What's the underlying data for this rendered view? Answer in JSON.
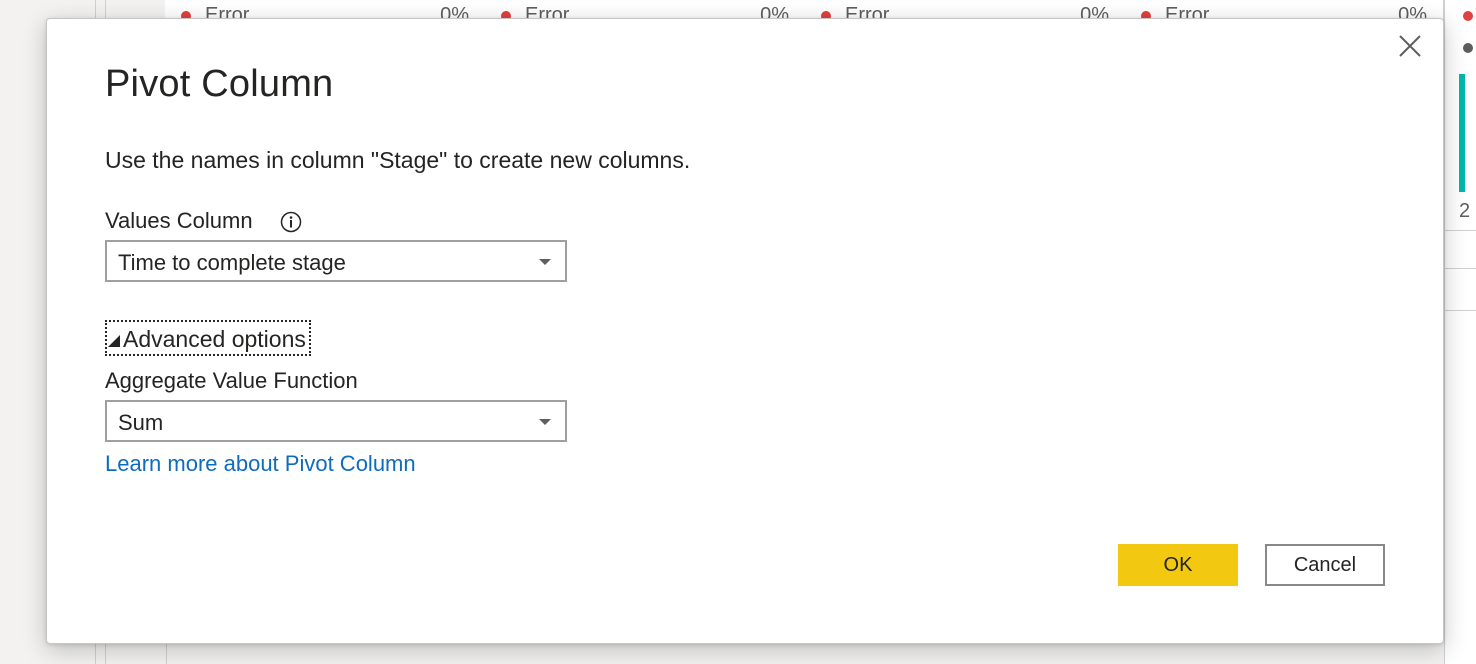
{
  "background": {
    "column_headers": [
      {
        "status": "Error",
        "pct": "0%"
      },
      {
        "status": "Error",
        "pct": "0%"
      },
      {
        "status": "Error",
        "pct": "0%"
      },
      {
        "status": "Error",
        "pct": "0%"
      }
    ],
    "right_edge_value": "2"
  },
  "dialog": {
    "title": "Pivot Column",
    "description": "Use the names in column \"Stage\" to create new columns.",
    "values_column": {
      "label": "Values Column",
      "selected": "Time to complete stage"
    },
    "advanced_options_label": "Advanced options",
    "aggregate": {
      "label": "Aggregate Value Function",
      "selected": "Sum"
    },
    "learn_more_link": "Learn more about Pivot Column",
    "buttons": {
      "ok": "OK",
      "cancel": "Cancel"
    }
  },
  "colors": {
    "ok_button": "#f2c811",
    "link": "#0f6cbd",
    "error_dot": "#e04141",
    "accent_bar": "#01b8aa"
  },
  "icons": [
    "close-icon",
    "info-icon",
    "chevron-down-icon",
    "expand-triangle-icon"
  ]
}
